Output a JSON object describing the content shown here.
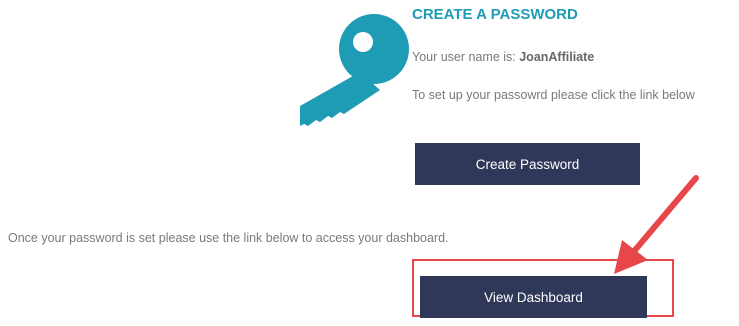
{
  "heading": "CREATE A PASSWORD",
  "username": {
    "prefix": "Your user name is: ",
    "value": "JoanAffiliate"
  },
  "instruction": "To set up your passowrd please click the link below",
  "create_button_label": "Create Password",
  "dashboard_note": "Once your password is set please use the link below to access your dashboard.",
  "dashboard_button_label": "View Dashboard",
  "icons": {
    "key": "key-icon",
    "arrow": "arrow-icon"
  },
  "colors": {
    "accent": "#1e9bb5",
    "button": "#30385a",
    "annotation": "#e8474a"
  }
}
